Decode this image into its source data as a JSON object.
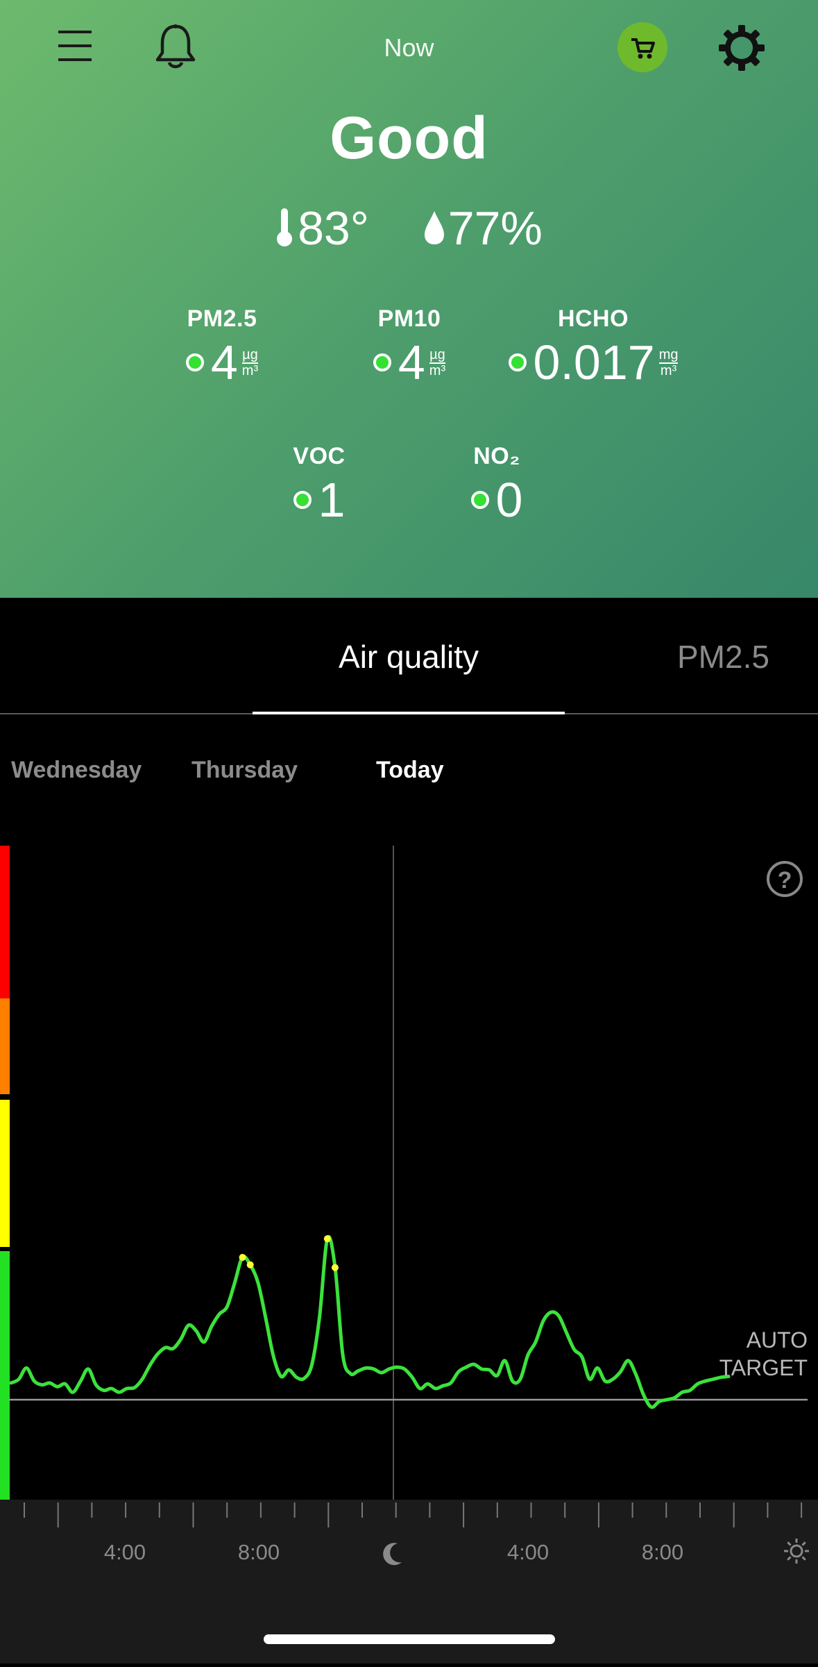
{
  "header": {
    "title": "Now",
    "menu_icon": "menu-icon",
    "bell_icon": "bell-icon",
    "cart_icon": "cart-icon",
    "settings_icon": "gear-icon",
    "cart_color": "#6fba2c"
  },
  "summary": {
    "status": "Good",
    "temperature": "83°",
    "humidity": "77%",
    "temperature_icon": "thermometer-icon",
    "humidity_icon": "droplet-icon"
  },
  "metrics": [
    {
      "label": "PM2.5",
      "value": "4",
      "unit_top": "µg",
      "unit_bottom": "m³"
    },
    {
      "label": "PM10",
      "value": "4",
      "unit_top": "µg",
      "unit_bottom": "m³"
    },
    {
      "label": "HCHO",
      "value": "0.017",
      "unit_top": "mg",
      "unit_bottom": "m³"
    },
    {
      "label": "VOC",
      "value": "1"
    },
    {
      "label": "NO₂",
      "value": "0"
    }
  ],
  "tabs": [
    {
      "label": "Air quality",
      "active": true
    },
    {
      "label": "PM2.5",
      "active": false
    }
  ],
  "days": [
    {
      "label": "Wednesday",
      "active": false
    },
    {
      "label": "Thursday",
      "active": false
    },
    {
      "label": "Today",
      "active": true
    }
  ],
  "chart_data": {
    "type": "line",
    "xlabel": "",
    "ylabel": "",
    "x_tick_labels": [
      "4:00",
      "8:00",
      "moon-icon",
      "4:00",
      "8:00",
      "sun-icon"
    ],
    "target_label_line1": "AUTO",
    "target_label_line2": "TARGET",
    "help_icon": "help-icon",
    "level_colors": [
      "#ff0000",
      "#ff7f00",
      "#ffff00",
      "#22e022"
    ],
    "series": [
      {
        "values": [
          0.18,
          0.22,
          0.34,
          0.2,
          0.16,
          0.18,
          0.14,
          0.17,
          0.08,
          0.2,
          0.33,
          0.16,
          0.1,
          0.12,
          0.08,
          0.12,
          0.13,
          0.22,
          0.37,
          0.49,
          0.56,
          0.55,
          0.65,
          0.8,
          0.74,
          0.62,
          0.79,
          0.92,
          1.0,
          1.26,
          1.53,
          1.45,
          1.26,
          0.88,
          0.47,
          0.25,
          0.32,
          0.24,
          0.23,
          0.38,
          0.9,
          1.73,
          1.42,
          0.48,
          0.28,
          0.31,
          0.34,
          0.33,
          0.29,
          0.33,
          0.35,
          0.33,
          0.24,
          0.12,
          0.17,
          0.12,
          0.15,
          0.18,
          0.3,
          0.35,
          0.38,
          0.33,
          0.32,
          0.26,
          0.42,
          0.2,
          0.22,
          0.48,
          0.62,
          0.85,
          0.94,
          0.9,
          0.72,
          0.54,
          0.46,
          0.22,
          0.34,
          0.2,
          0.22,
          0.3,
          0.42,
          0.27,
          0.05,
          -0.08,
          -0.02,
          0.0,
          0.02,
          0.08,
          0.1,
          0.17,
          0.2,
          0.22,
          0.24,
          0.25
        ]
      }
    ]
  }
}
